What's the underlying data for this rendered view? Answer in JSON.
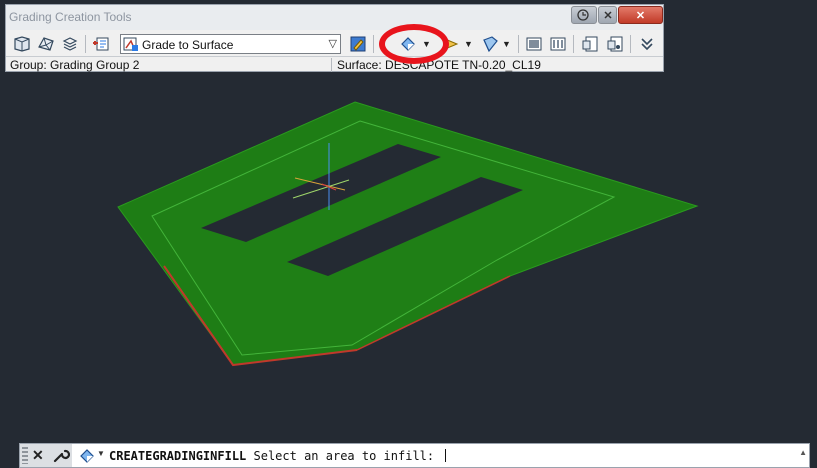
{
  "toolbar_window": {
    "title": "Grading Creation Tools",
    "grade_combo_value": "Grade to Surface",
    "group_label": "Group: Grading Group 2",
    "surface_label": "Surface: DESCAPOTE TN-0.20_CL19",
    "title_buttons": {
      "close": "✕"
    },
    "icons": [
      "set-grading-group-icon",
      "set-target-surface-icon",
      "grading-layers-icon",
      "grading-criteria-icon",
      "edit-criteria-icon",
      "create-infill-icon",
      "create-grading-icon",
      "raise-lower-icon",
      "grading-elevation-icon",
      "select-grading-icon",
      "grading-properties-icon",
      "collapse-toolbar-icon"
    ]
  },
  "command_line": {
    "command": "CREATEGRADINGINFILL",
    "prompt": " Select an area to infill: "
  },
  "colors": {
    "viewport_bg": "#242a33",
    "grading_fill": "#1e7d15",
    "highlight": "#e8141c"
  }
}
